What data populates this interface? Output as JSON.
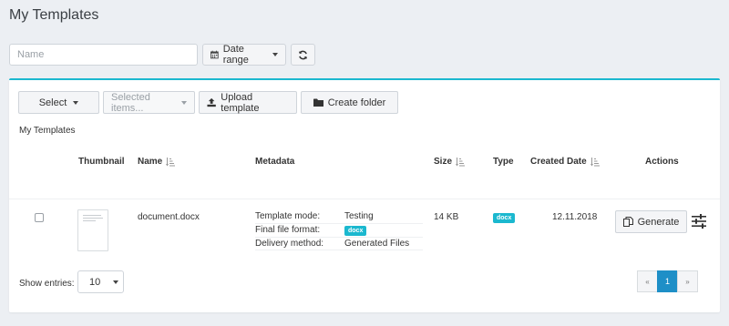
{
  "page": {
    "title": "My Templates"
  },
  "filters": {
    "name_placeholder": "Name",
    "date_range_label": "Date range",
    "refresh_icon": "refresh-icon"
  },
  "toolbar": {
    "select_label": "Select",
    "selected_items_label": "Selected items...",
    "upload_label": "Upload template",
    "create_folder_label": "Create folder"
  },
  "section_label": "My Templates",
  "table": {
    "headers": {
      "thumbnail": "Thumbnail",
      "name": "Name",
      "metadata": "Metadata",
      "size": "Size",
      "type": "Type",
      "created_date": "Created Date",
      "actions": "Actions"
    },
    "rows": [
      {
        "name": "document.docx",
        "metadata": [
          {
            "key": "Template mode:",
            "value": "Testing"
          },
          {
            "key": "Final file format:",
            "value": "docx"
          },
          {
            "key": "Delivery method:",
            "value": "Generated Files"
          }
        ],
        "size": "14 KB",
        "type": "docx",
        "created_date": "12.11.2018",
        "generate_label": "Generate"
      }
    ]
  },
  "footer": {
    "show_entries_label": "Show entries:",
    "entries_value": "10",
    "pagination": {
      "prev": "«",
      "current": "1",
      "next": "»"
    }
  },
  "colors": {
    "accent": "#1bb8cf",
    "active_page": "#1e8fc7",
    "background": "#eceff3"
  }
}
